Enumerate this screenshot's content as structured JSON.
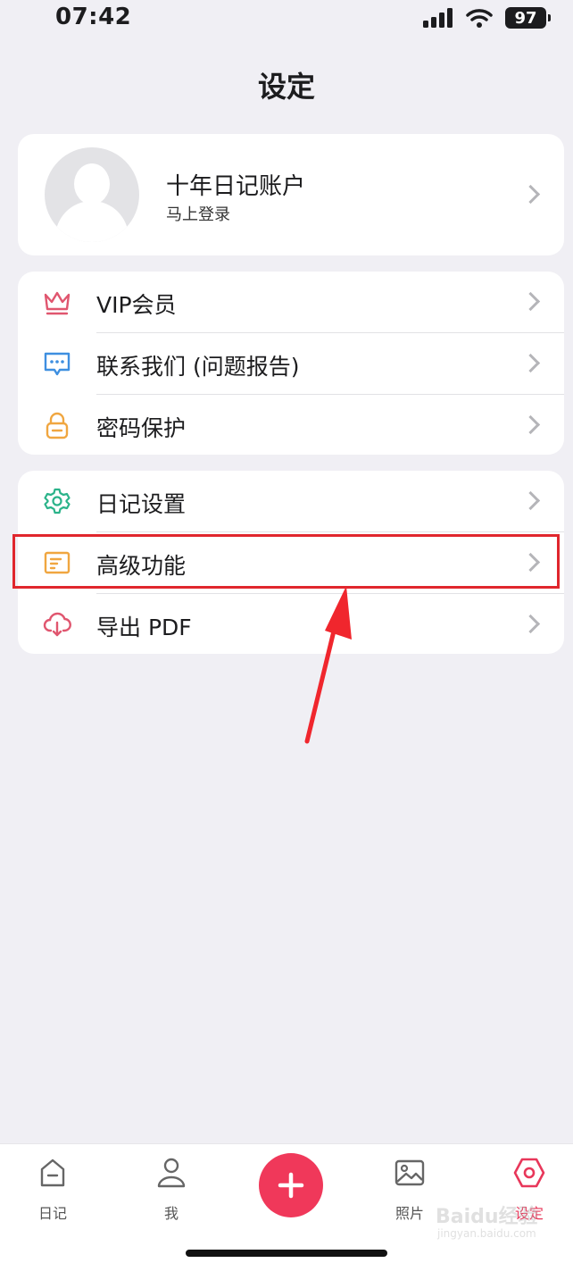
{
  "status_bar": {
    "time": "07:42",
    "battery": "97"
  },
  "page_title": "设定",
  "profile": {
    "name": "十年日记账户",
    "subtitle": "马上登录"
  },
  "menu_group_1": [
    {
      "label": "VIP会员",
      "icon": "crown-icon"
    },
    {
      "label": "联系我们 (问题报告)",
      "icon": "chat-icon"
    },
    {
      "label": "密码保护",
      "icon": "lock-icon"
    }
  ],
  "menu_group_2": [
    {
      "label": "日记设置",
      "icon": "gear-icon"
    },
    {
      "label": "高级功能",
      "icon": "card-icon"
    },
    {
      "label": "导出 PDF",
      "icon": "cloud-download-icon"
    }
  ],
  "tabs": [
    {
      "label": "日记",
      "icon": "diary-icon"
    },
    {
      "label": "我",
      "icon": "person-icon"
    },
    {
      "label": "",
      "icon": "plus-icon"
    },
    {
      "label": "照片",
      "icon": "photo-icon"
    },
    {
      "label": "设定",
      "icon": "settings-hexagon-icon"
    }
  ],
  "watermark": {
    "text": "Baidu经验",
    "sub": "jingyan.baidu.com"
  },
  "colors": {
    "accent": "#f0385a",
    "highlight_border": "#e0262d",
    "background": "#f0eff4"
  }
}
